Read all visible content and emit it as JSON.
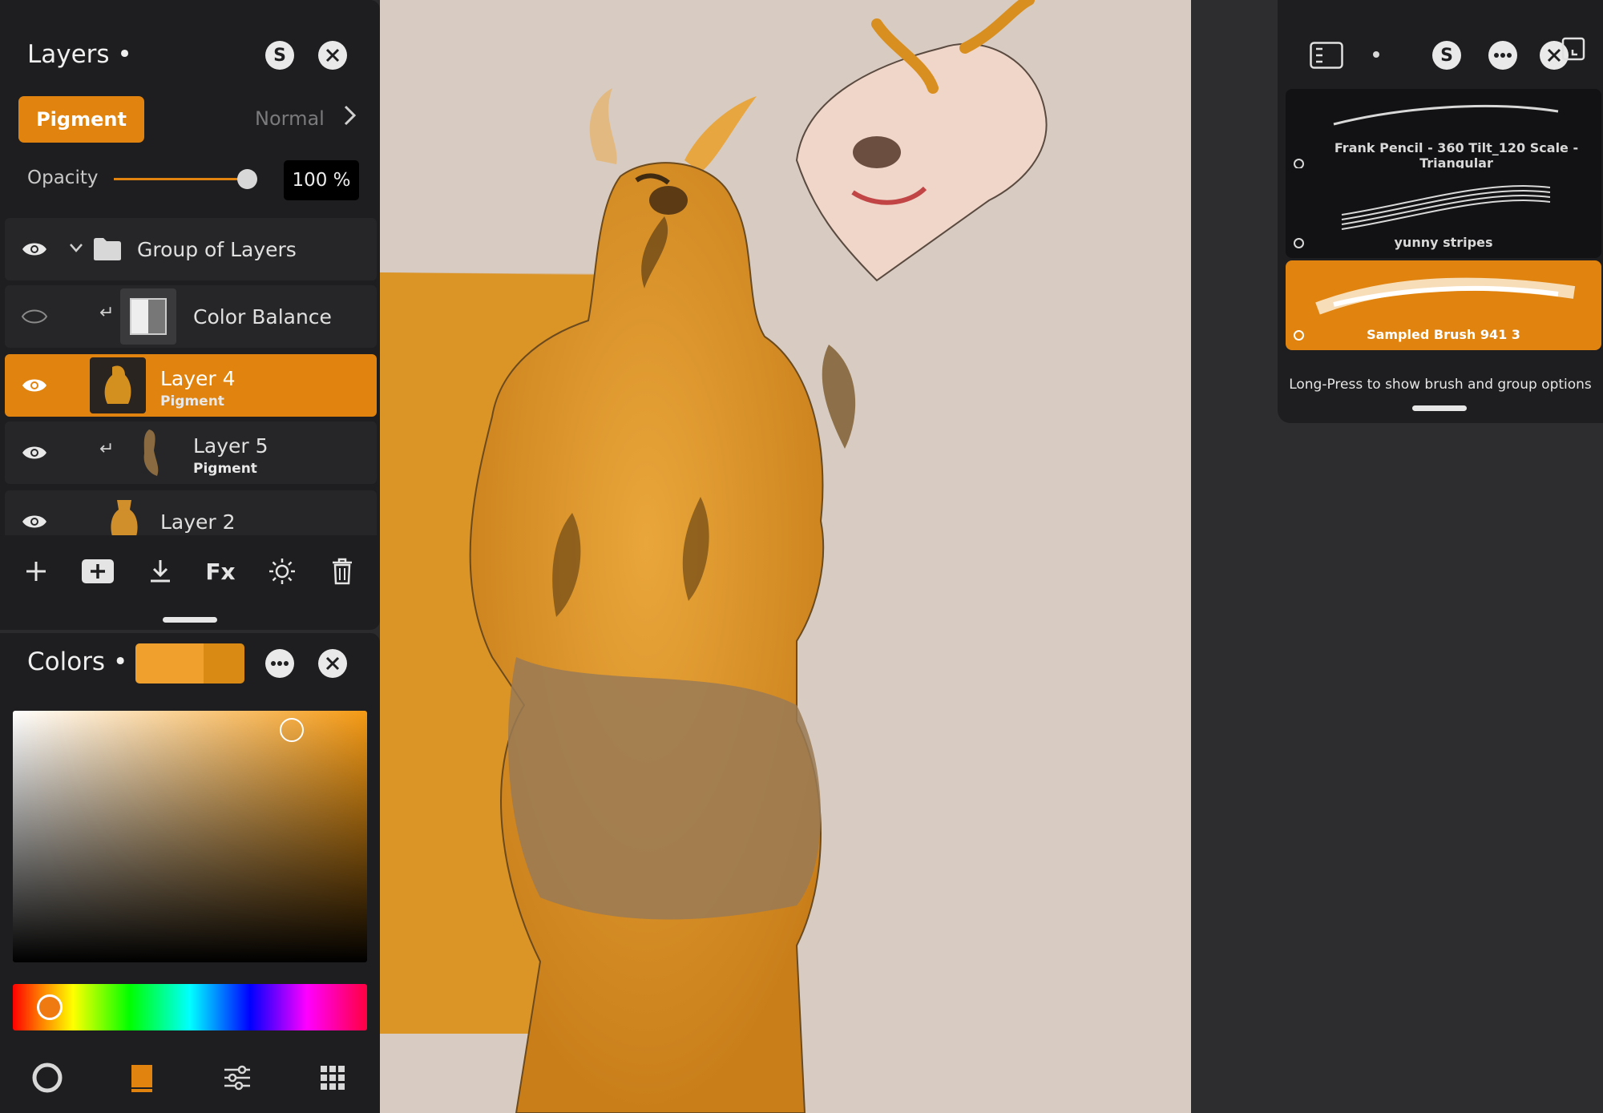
{
  "layers_panel": {
    "title": "Layers •",
    "s_button": "S",
    "close_button": "✕",
    "blend_group_button": "Pigment",
    "blend_mode": "Normal",
    "opacity_label": "Opacity",
    "opacity_value": "100 %",
    "opacity_fraction": 1.0,
    "layers": [
      {
        "name": "Group of Layers",
        "visible": true,
        "type": "group"
      },
      {
        "name": "Color Balance",
        "visible": false,
        "type": "adjustment",
        "clipped": true
      },
      {
        "name": "Layer 4",
        "subtitle": "Pigment",
        "visible": true,
        "selected": true
      },
      {
        "name": "Layer 5",
        "subtitle": "Pigment",
        "visible": true,
        "clipped": true
      },
      {
        "name": "Layer 2",
        "visible": true
      }
    ],
    "tools": [
      "add-icon",
      "add-group-icon",
      "merge-down-icon",
      "fx",
      "adjust-icon",
      "trash-icon"
    ],
    "fx_label": "Fx"
  },
  "colors_panel": {
    "title": "Colors •",
    "primary_color": "#f0a02c",
    "secondary_color": "#d98a14",
    "hue_color": "#f59a14",
    "tabs": [
      "wheel-icon",
      "swatch-icon",
      "sliders-icon",
      "palette-grid-icon"
    ]
  },
  "brush_panel": {
    "s_button": "S",
    "brushes": [
      {
        "name": "Frank Pencil - 360 Tilt_120 Scale - Triangular",
        "selected": false
      },
      {
        "name": "yunny stripes",
        "selected": false
      },
      {
        "name": "Sampled Brush 941 3",
        "selected": true
      }
    ],
    "hint": "Long-Press to show brush and group options"
  },
  "colors": {
    "accent": "#e0840f",
    "panel": "#1e1e20",
    "canvas": "#d8ccc2"
  }
}
